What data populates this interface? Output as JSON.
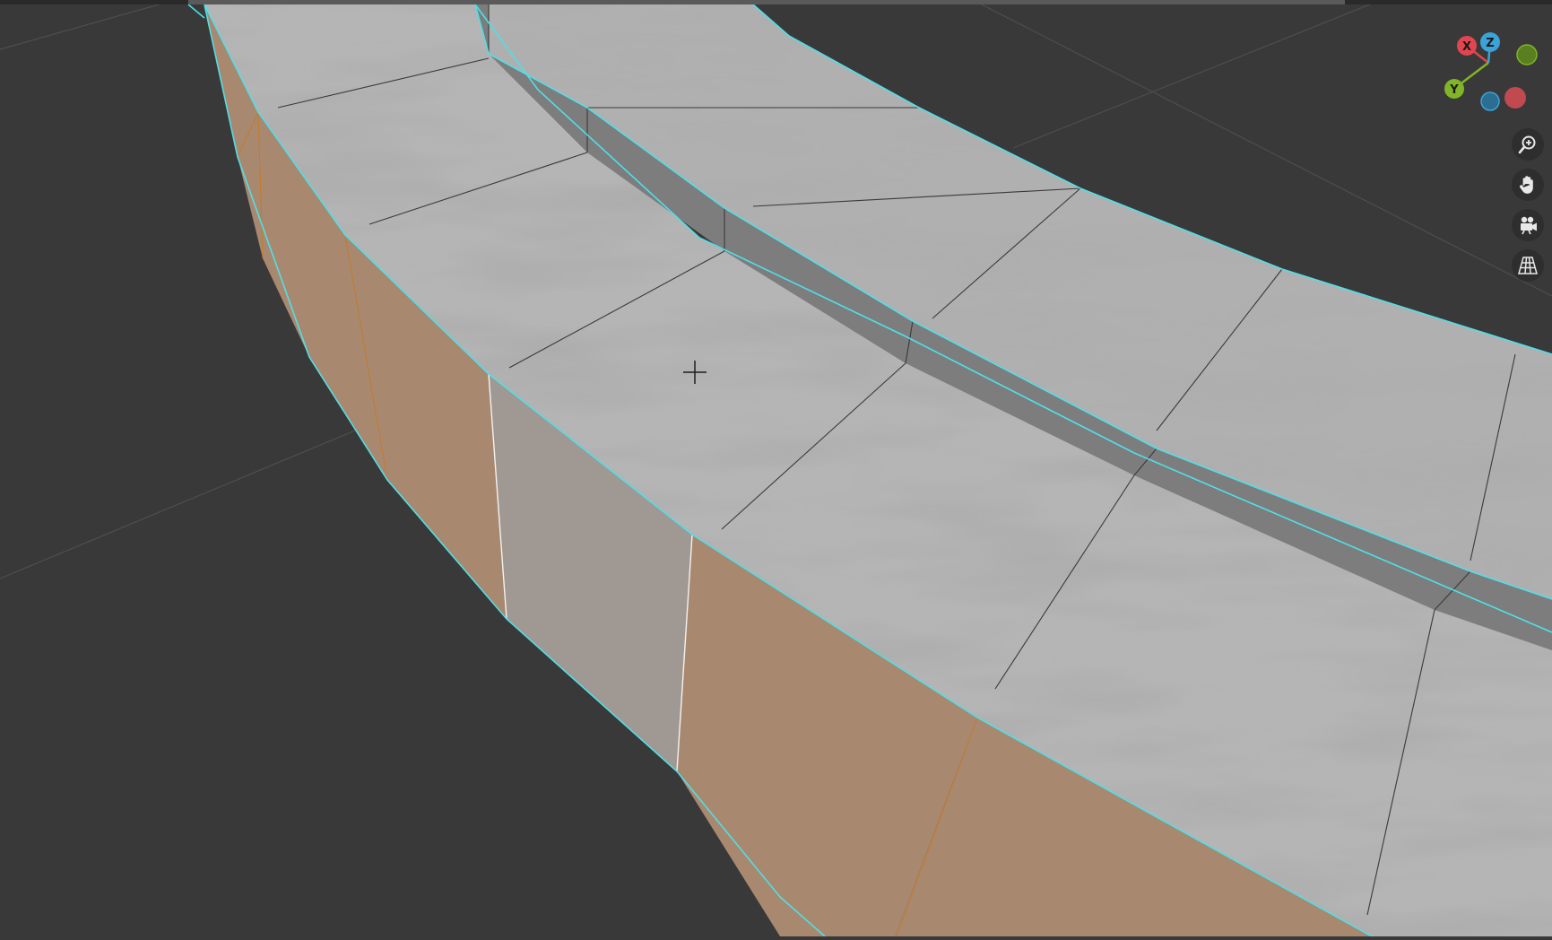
{
  "viewport": {
    "mode": "Edit Mode",
    "background_color": "#393939",
    "grid_line_color": "#4e4e4e",
    "selected_edge_color": "#4fe0e8",
    "selected_face_color": "#a98870",
    "unselected_side_color": "#a09893",
    "top_surface_color": "#b6b6b6",
    "inner_wall_color": "#7d7d7d"
  },
  "cursor": {
    "icon": "3d-cursor-crosshair-icon"
  },
  "gizmo": {
    "x_label": "X",
    "y_label": "Y",
    "z_label": "Z",
    "x_color": "#e0464f",
    "y_color": "#7fb526",
    "z_color": "#3ba3d8",
    "neg_x_color": "#a13a3f",
    "neg_y_color": "#5a7f20",
    "neg_z_color": "#2b6e91"
  },
  "nav_buttons": [
    {
      "name": "zoom-button",
      "icon": "zoom-magnifier-icon"
    },
    {
      "name": "pan-button",
      "icon": "pan-hand-icon"
    },
    {
      "name": "camera-view-button",
      "icon": "camera-icon"
    },
    {
      "name": "perspective-toggle-button",
      "icon": "perspective-grid-icon"
    }
  ]
}
